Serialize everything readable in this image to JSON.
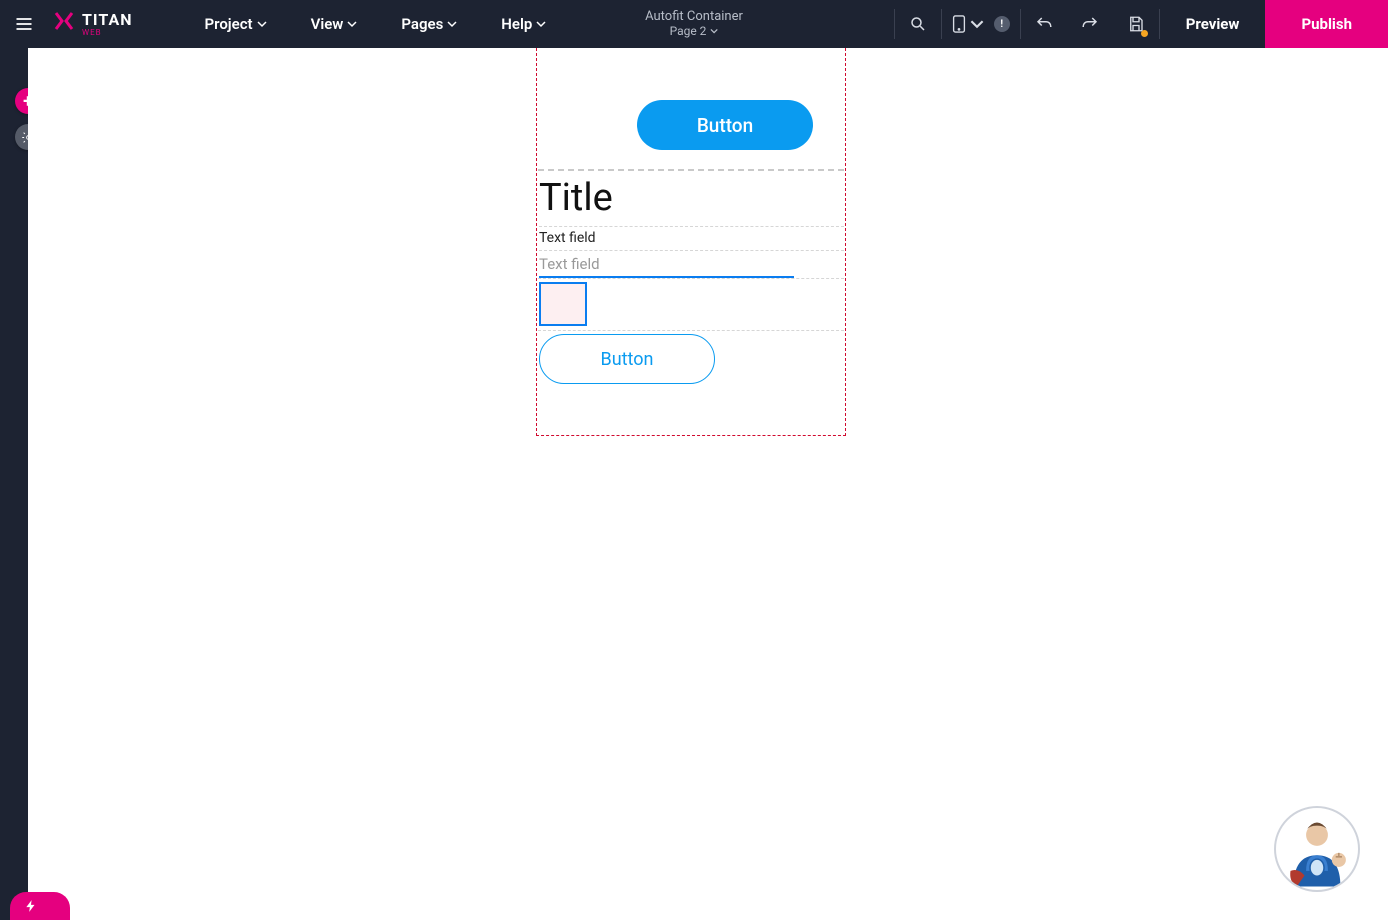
{
  "brand": {
    "title": "TITAN",
    "sub": "WEB"
  },
  "menus": {
    "project": "Project",
    "view": "View",
    "pages": "Pages",
    "help": "Help"
  },
  "center": {
    "title": "Autofit Container",
    "page": "Page 2"
  },
  "toolbar": {
    "device_badge": "!",
    "preview": "Preview",
    "publish": "Publish"
  },
  "canvas": {
    "top_button": "Button",
    "title": "Title",
    "tf_label": "Text field",
    "tf_placeholder": "Text field",
    "outline_button": "Button"
  },
  "bottom_pill": ""
}
